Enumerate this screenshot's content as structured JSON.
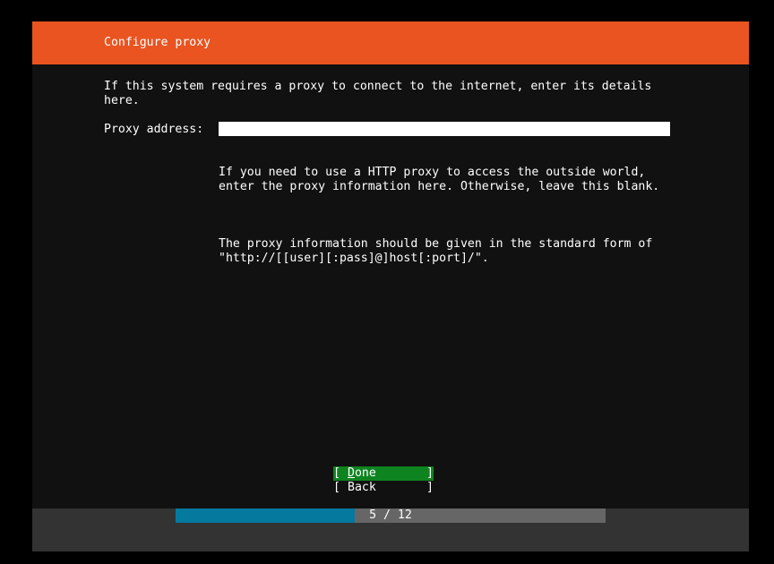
{
  "header": {
    "title": "Configure proxy"
  },
  "intro": {
    "text": "If this system requires a proxy to connect to the internet, enter its details\nhere."
  },
  "proxy_field": {
    "label": "Proxy address:",
    "value": ""
  },
  "help": {
    "paragraph_1": "If you need to use a HTTP proxy to access the outside world,\nenter the proxy information here. Otherwise, leave this blank.",
    "paragraph_2": "The proxy information should be given in the standard form of\n\"http://[[user][:pass]@]host[:port]/\"."
  },
  "buttons": {
    "open_bracket": "[",
    "close_bracket": "]",
    "done_label": "Done",
    "back_label": "Back"
  },
  "progress": {
    "current": 5,
    "total": 12,
    "text": "5 / 12"
  },
  "colors": {
    "header_background": "#e95420",
    "screen_background": "#111111",
    "selected_button": "#0e8420",
    "progress_fill": "#06799f",
    "progress_track": "#666666",
    "footer_background": "#333333"
  }
}
